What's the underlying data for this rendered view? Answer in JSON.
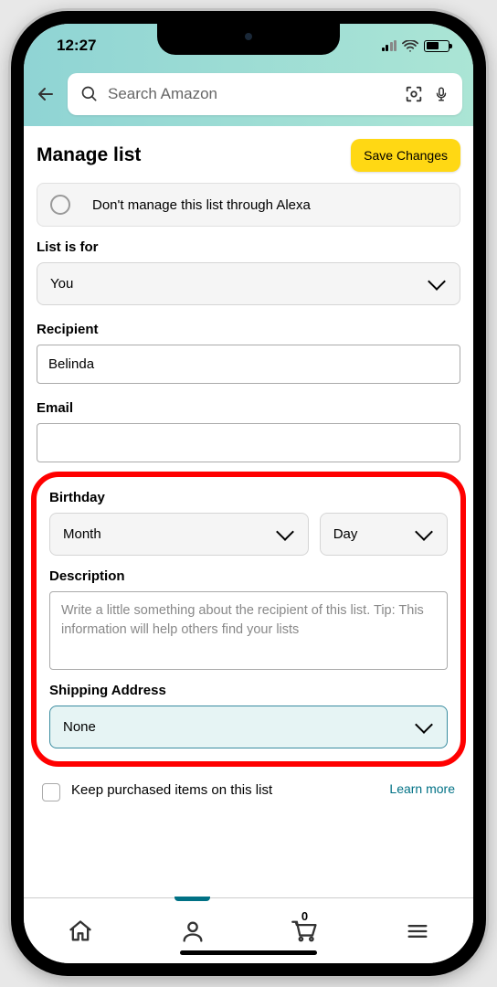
{
  "status": {
    "time": "12:27"
  },
  "header": {
    "search_placeholder": "Search Amazon"
  },
  "page": {
    "title": "Manage list",
    "save_button": "Save Changes",
    "alexa_option": "Don't manage this list through Alexa"
  },
  "fields": {
    "list_for": {
      "label": "List is for",
      "value": "You"
    },
    "recipient": {
      "label": "Recipient",
      "value": "Belinda"
    },
    "email": {
      "label": "Email",
      "value": ""
    },
    "birthday": {
      "label": "Birthday",
      "month": "Month",
      "day": "Day"
    },
    "description": {
      "label": "Description",
      "placeholder": "Write a little something about the recipient of this list. Tip: This information will help others find your lists"
    },
    "shipping": {
      "label": "Shipping Address",
      "value": "None"
    },
    "keep_purchased": {
      "label": "Keep purchased items on this list",
      "learn_more": "Learn more"
    }
  },
  "nav": {
    "cart_count": "0"
  }
}
